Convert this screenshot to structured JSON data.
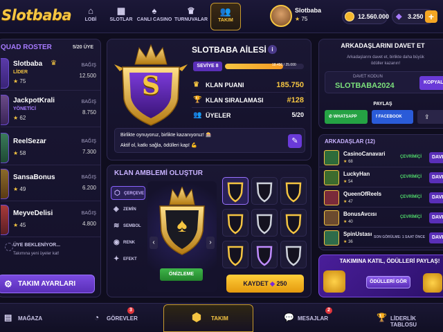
{
  "app": {
    "logo": "Slotbaba"
  },
  "nav": [
    {
      "label": "LOBİ",
      "icon": "home-icon",
      "glyph": "⌂"
    },
    {
      "label": "SLOTLAR",
      "icon": "grid-icon",
      "glyph": "▦"
    },
    {
      "label": "CANLI CASINO",
      "icon": "cards-icon",
      "glyph": "♠"
    },
    {
      "label": "TURNUVALAR",
      "icon": "trophy-icon",
      "glyph": "♛"
    },
    {
      "label": "TAKIM",
      "icon": "team-icon",
      "glyph": "👥"
    }
  ],
  "user": {
    "name": "Slotbaba",
    "level": "75",
    "coins": "12.560.000",
    "gems": "3.250",
    "plus": "+"
  },
  "squad": {
    "title": "QUAD ROSTER",
    "count": "5/20 ÜYE",
    "members": [
      {
        "name": "Slotbaba",
        "role": "LİDER",
        "level": "75",
        "bonus_label": "BAĞIŞ",
        "bonus": "12.500"
      },
      {
        "name": "JackpotKrali",
        "role": "YÖNETİCİ",
        "level": "62",
        "bonus_label": "BAĞIŞ",
        "bonus": "8.750"
      },
      {
        "name": "ReelSezar",
        "role": "",
        "level": "58",
        "bonus_label": "BAĞIŞ",
        "bonus": "7.300"
      },
      {
        "name": "SansaBonus",
        "role": "",
        "level": "49",
        "bonus_label": "BAĞIŞ",
        "bonus": "6.200"
      },
      {
        "name": "MeyveDelisi",
        "role": "",
        "level": "45",
        "bonus_label": "BAĞIŞ",
        "bonus": "4.800"
      }
    ],
    "waiting_title": "ÜYE BEKLENİYOR...",
    "waiting_sub": "Takımına yeni üyeler kat!",
    "settings_label": "TAKIM AYARLARI"
  },
  "team": {
    "name": "SLOTBABA AİLESİ",
    "level": "SEVİYE 8",
    "xp": "18.450 / 25.000",
    "xp_fraction": 0.738,
    "stats": [
      {
        "label": "KLAN PUANI",
        "value": "185.750",
        "icon": "crown-icon",
        "glyph": "♛"
      },
      {
        "label": "KLAN SIRALAMASI",
        "value": "#128",
        "icon": "trophy-icon",
        "glyph": "🏆"
      },
      {
        "label": "ÜYELER",
        "value": "5/20",
        "icon": "users-icon",
        "glyph": "👥"
      }
    ],
    "motto_line1": "Birlikte oynuyoruz, birlikte kazanıyoruz! 🎰",
    "motto_line2": "Aktif ol, katkı sağla, ödülleri kap! 💪",
    "emblem_letter": "S"
  },
  "emblem_builder": {
    "title": "KLAN AMBLEMİ OLUŞTUR",
    "tabs": [
      {
        "label": "ÇERÇEVE",
        "icon": "frame-icon",
        "glyph": "⬡"
      },
      {
        "label": "ZEMİN",
        "icon": "layers-icon",
        "glyph": "◈"
      },
      {
        "label": "SEMBOL",
        "icon": "stack-icon",
        "glyph": "≋"
      },
      {
        "label": "RENK",
        "icon": "palette-icon",
        "glyph": "◉"
      },
      {
        "label": "EFEKT",
        "icon": "sparkle-icon",
        "glyph": "✦"
      }
    ],
    "preview_label": "ÖNİZLEME",
    "save_label": "KAYDET",
    "save_cost": "250",
    "shield_colors": [
      "#f5c542",
      "#cfd3dc",
      "#f5c542",
      "#f5c542",
      "#cfd3dc",
      "#f5c542",
      "#f5c542",
      "#c08cff",
      "#cfd3dc"
    ]
  },
  "invite": {
    "title": "ARKADAŞLARINI DAVET ET",
    "desc": "Arkadaşlarını davet et, birlikte daha büyük ödüller kazanın!",
    "code_label": "DAVET KODUN",
    "code": "SLOTBABA2024",
    "copy_label": "KOPYALA",
    "share_label": "PAYLAŞ",
    "whatsapp": "WHATSAPP",
    "facebook": "FACEBOOK"
  },
  "friends": {
    "title": "ARKADAŞLAR (12)",
    "items": [
      {
        "name": "CasinoCanavari",
        "level": "68",
        "status": "ÇEVRİMİÇİ",
        "btn": "DAVET",
        "color": "#2e6b3a"
      },
      {
        "name": "LuckyHan",
        "level": "54",
        "status": "ÇEVRİMİÇİ",
        "btn": "DAVET",
        "color": "#3c6b2e"
      },
      {
        "name": "QueenOfReels",
        "level": "47",
        "status": "ÇEVRİMİÇİ",
        "btn": "DAVET",
        "color": "#7a2a3a"
      },
      {
        "name": "BonusAvcısı",
        "level": "40",
        "status": "ÇEVRİMİÇİ",
        "btn": "DAVET",
        "color": "#6b4a2e"
      },
      {
        "name": "SpinUstası",
        "level": "36",
        "status": "SON GÖRÜLME: 1 SAAT ÖNCE",
        "btn": "DAVET",
        "color": "#2e6b4a"
      }
    ]
  },
  "promo": {
    "title": "TAKIMINA KATIL, ÖDÜLLERİ PAYLAŞ!",
    "button": "ÖDÜLLERİ GÖR"
  },
  "bottom_nav": [
    {
      "label": "MAĞAZA",
      "icon": "shop-icon",
      "glyph": "▤",
      "badge": ""
    },
    {
      "label": "GÖREVLER",
      "icon": "tasks-icon",
      "glyph": "◔",
      "badge": "3"
    },
    {
      "label": "TAKIM",
      "icon": "team-icon",
      "glyph": "⬢",
      "badge": ""
    },
    {
      "label": "MESAJLAR",
      "icon": "chat-icon",
      "glyph": "💬",
      "badge": "2"
    },
    {
      "label": "LİDERLİK TABLOSU",
      "icon": "trophy-icon",
      "glyph": "🏆",
      "badge": ""
    }
  ],
  "colors": {
    "gold": "#f5c542",
    "purple": "#8a63ff",
    "bg": "#0f0d1e"
  }
}
